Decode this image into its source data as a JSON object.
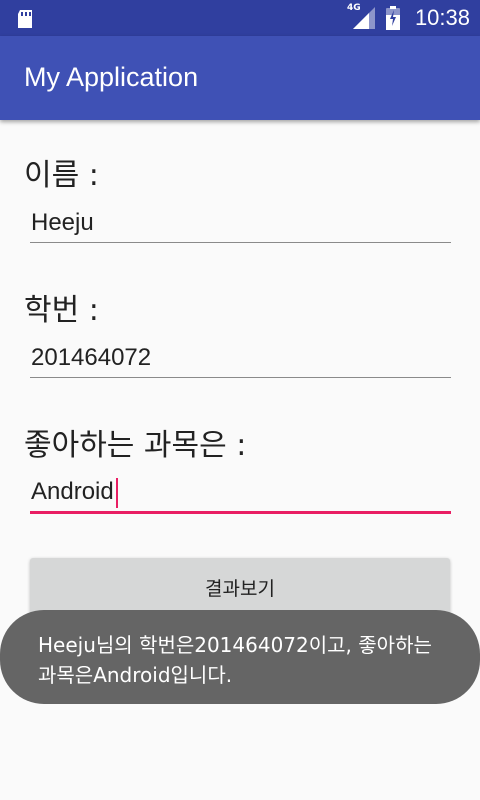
{
  "status_bar": {
    "network": "4G",
    "time": "10:38"
  },
  "app_bar": {
    "title": "My Application"
  },
  "form": {
    "name_label": "이름 :",
    "name_value": "Heeju",
    "id_label": "학번 :",
    "id_value": "201464072",
    "subject_label": "좋아하는 과목은 :",
    "subject_value": "Android",
    "button_label": "결과보기"
  },
  "toast": {
    "message": "Heeju님의 학번은201464072이고, 좋아하는 과목은Android입니다."
  },
  "colors": {
    "status_bar": "#303f9f",
    "app_bar": "#3f51b5",
    "accent": "#e91e63"
  }
}
